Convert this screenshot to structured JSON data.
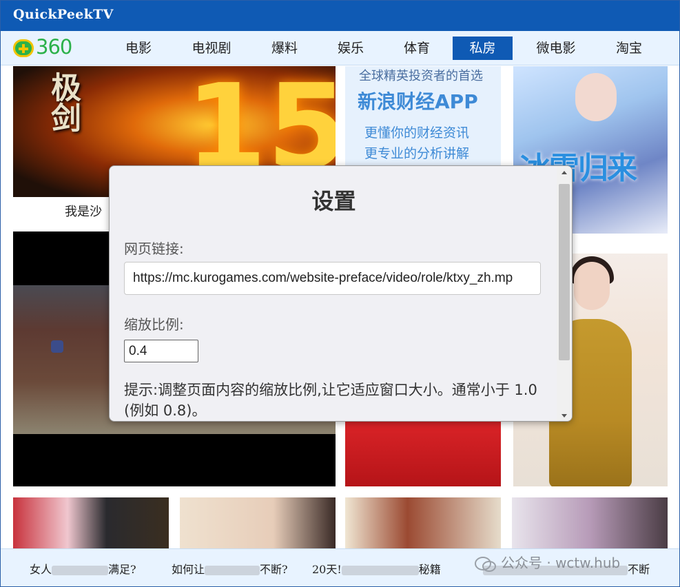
{
  "app": {
    "title": "QuickPeekTV"
  },
  "logo": {
    "text": "360",
    "brand_color": "#2cb14a",
    "icon": "360-logo-icon"
  },
  "nav": {
    "items": [
      "电影",
      "电视剧",
      "爆料",
      "娱乐",
      "体育",
      "私房",
      "微电影",
      "淘宝"
    ],
    "active_index": 5,
    "active_color": "#0f5ab4"
  },
  "content": {
    "caption": "我是沙",
    "ad": {
      "line1": "全球精英投资者的首选",
      "line2": "新浪财经APP",
      "line3": "更懂你的财经资讯",
      "line4": "更专业的分析讲解"
    },
    "sword_glyph": "极剑",
    "sword_number": "15",
    "ice_title": "冰雪归来"
  },
  "bottom": {
    "headlines": [
      {
        "pre": "女人",
        "post": "满足?"
      },
      {
        "pre": "如何让",
        "post": "不断?"
      },
      {
        "pre": "20天!",
        "post": "秘籍"
      },
      {
        "pre": "",
        "post": "不断"
      }
    ],
    "watermark": "公众号 · wctw.hub"
  },
  "dialog": {
    "title": "设置",
    "url_label": "网页链接:",
    "url_value": "https://mc.kurogames.com/website-preface/video/role/ktxy_zh.mp",
    "scale_label": "缩放比例:",
    "scale_value": "0.4",
    "hint": "提示:调整页面内容的缩放比例,让它适应窗口大小。通常小于 1.0 (例如 0.8)。"
  }
}
